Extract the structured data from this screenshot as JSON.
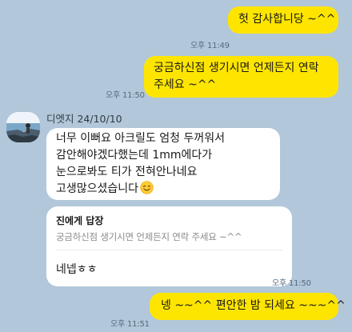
{
  "messages": {
    "m1": {
      "text": "헛 감사합니당 ~^^",
      "time": "오후 11:49"
    },
    "m2": {
      "lines": [
        "궁금하신점 생기시면 언제든지 연락",
        "주세요 ~^^"
      ],
      "time": "오후 11:50"
    },
    "review": {
      "sender": "디엣지 24/10/10",
      "lines": [
        "너무 이뻐요 아크릴도 엄청 두꺼워서",
        "감안해야겠다했는데 1mm에다가",
        "눈으로봐도 티가 전혀안나네요",
        "고생많으셨습니다"
      ],
      "emoji": "smiling-face-with-smiling-eyes"
    },
    "reply": {
      "header": "진에게 답장",
      "quote": "궁금하신점 생기시면 언제든지 연락 주세요 ~^^",
      "answer": "네넵ㅎㅎ",
      "time": "오후 11:50"
    },
    "m3": {
      "text": "넹 ~~^^  편안한 밤 되세요 ~~~^^",
      "time": "오후 11:51"
    }
  },
  "colors": {
    "background": "#b2c7d9",
    "mine_bubble": "#fee500",
    "theirs_bubble": "#ffffff",
    "reply_header_text": "#191919",
    "quote_text": "#8b8b8b"
  }
}
